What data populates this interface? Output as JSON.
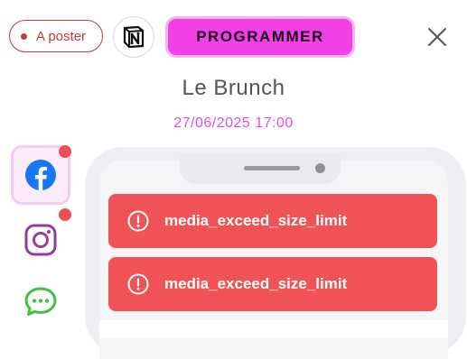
{
  "status": {
    "label": "A poster",
    "color": "#c9383d"
  },
  "toolbar": {
    "notion_icon": "notion-logo-icon",
    "schedule_label": "PROGRAMMER",
    "schedule_color": "#f040e6",
    "close_icon": "close-icon"
  },
  "post": {
    "title": "Le Brunch",
    "datetime": "27/06/2025 17:00"
  },
  "networks": [
    {
      "name": "facebook",
      "icon": "facebook-icon",
      "selected": true,
      "has_error": true
    },
    {
      "name": "instagram",
      "icon": "instagram-icon",
      "selected": false,
      "has_error": true
    },
    {
      "name": "messages",
      "icon": "chat-bubble-icon",
      "selected": false,
      "has_error": false
    }
  ],
  "preview": {
    "errors": [
      {
        "icon": "alert-circle-icon",
        "message": "media_exceed_size_limit"
      },
      {
        "icon": "alert-circle-icon",
        "message": "media_exceed_size_limit"
      }
    ],
    "error_color": "#ef5355"
  }
}
